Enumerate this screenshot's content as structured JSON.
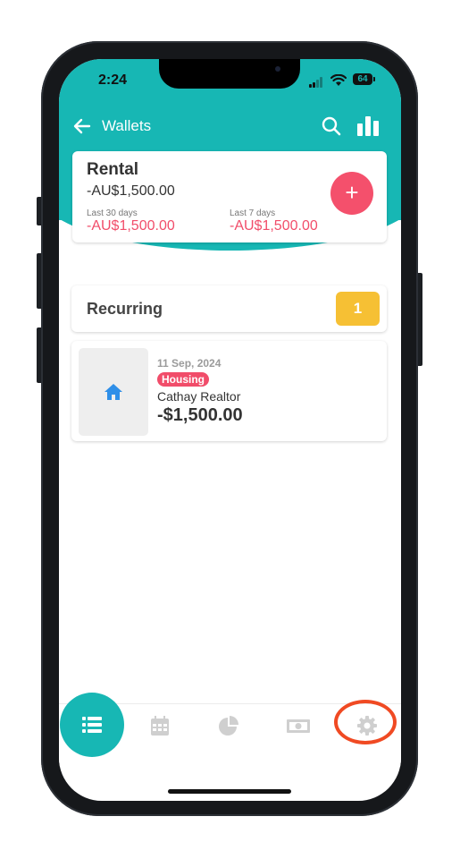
{
  "status_bar": {
    "time": "2:24",
    "battery": "64"
  },
  "app_bar": {
    "title": "Wallets"
  },
  "wallet": {
    "name": "Rental",
    "balance": "-AU$1,500.00",
    "last30_label": "Last 30 days",
    "last30_value": "-AU$1,500.00",
    "last7_label": "Last 7 days",
    "last7_value": "-AU$1,500.00",
    "add_label": "+"
  },
  "recurring": {
    "title": "Recurring",
    "count": "1"
  },
  "transaction": {
    "date": "11 Sep, 2024",
    "category": "Housing",
    "payee": "Cathay Realtor",
    "amount": "-$1,500.00"
  },
  "nav": {
    "items": [
      "list-icon",
      "calendar-icon",
      "pie-chart-icon",
      "cash-icon",
      "gear-icon"
    ],
    "active": "list-icon"
  },
  "colors": {
    "accent": "#17b7b4",
    "negative": "#f14d6a",
    "badge": "#f6c034",
    "highlight": "#f04a23"
  }
}
